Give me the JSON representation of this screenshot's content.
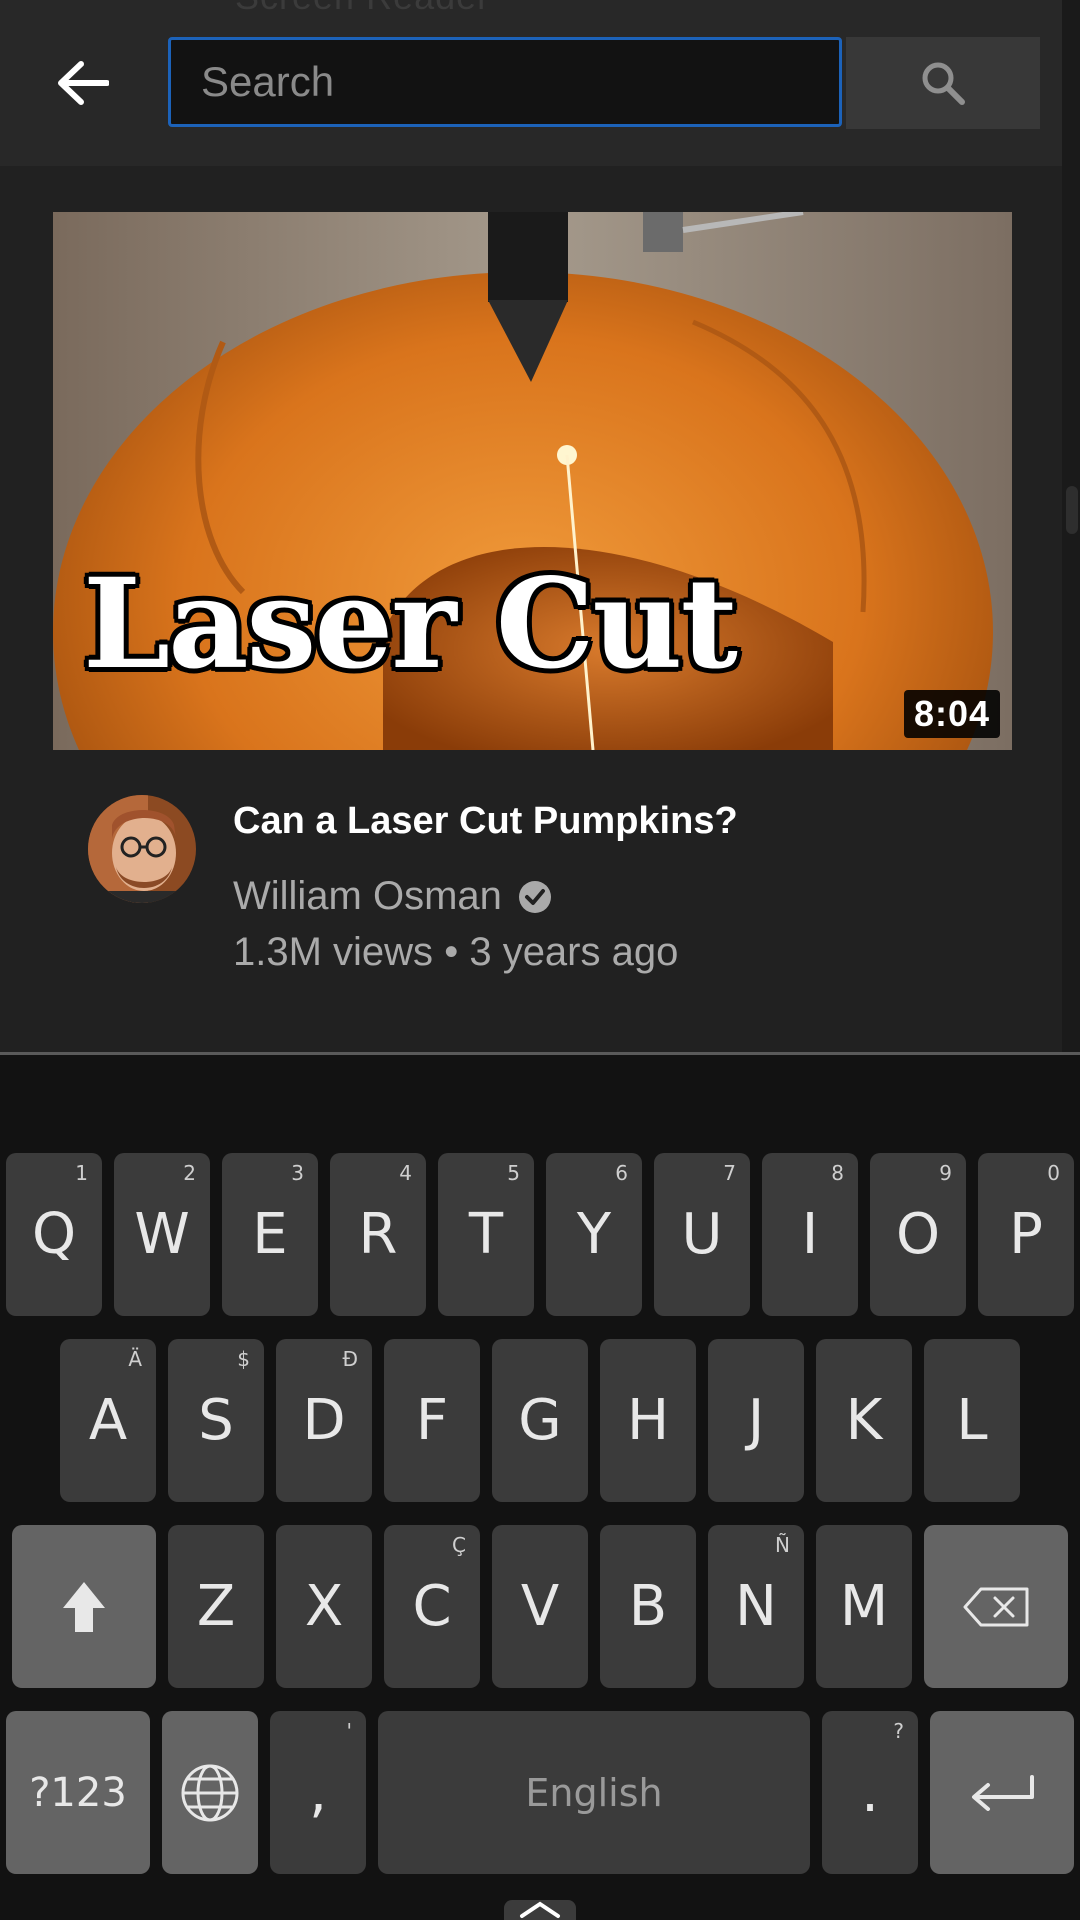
{
  "header": {
    "peek_text": "Screen Reader",
    "search_placeholder": "Search",
    "search_value": ""
  },
  "video": {
    "thumbnail_caption": "Laser Cut",
    "duration": "8:04",
    "title": "Can a Laser Cut Pumpkins?",
    "channel": "William Osman",
    "views": "1.3M views",
    "separator": "•",
    "age": "3 years ago"
  },
  "keyboard": {
    "row1": [
      {
        "key": "Q",
        "hint": "1"
      },
      {
        "key": "W",
        "hint": "2"
      },
      {
        "key": "E",
        "hint": "3"
      },
      {
        "key": "R",
        "hint": "4"
      },
      {
        "key": "T",
        "hint": "5"
      },
      {
        "key": "Y",
        "hint": "6"
      },
      {
        "key": "U",
        "hint": "7"
      },
      {
        "key": "I",
        "hint": "8"
      },
      {
        "key": "O",
        "hint": "9"
      },
      {
        "key": "P",
        "hint": "0"
      }
    ],
    "row2": [
      {
        "key": "A",
        "hint": "Ä"
      },
      {
        "key": "S",
        "hint": "$"
      },
      {
        "key": "D",
        "hint": "Ð"
      },
      {
        "key": "F",
        "hint": ""
      },
      {
        "key": "G",
        "hint": ""
      },
      {
        "key": "H",
        "hint": ""
      },
      {
        "key": "J",
        "hint": ""
      },
      {
        "key": "K",
        "hint": ""
      },
      {
        "key": "L",
        "hint": ""
      }
    ],
    "row3": [
      {
        "key": "Z",
        "hint": ""
      },
      {
        "key": "X",
        "hint": ""
      },
      {
        "key": "C",
        "hint": "Ç"
      },
      {
        "key": "V",
        "hint": ""
      },
      {
        "key": "B",
        "hint": ""
      },
      {
        "key": "N",
        "hint": "Ñ"
      },
      {
        "key": "M",
        "hint": ""
      }
    ],
    "symbols_label": "?123",
    "comma": ",",
    "comma_hint": "'",
    "space_label": "English",
    "period": ".",
    "period_hint": "?"
  },
  "icons": [
    "back-arrow-icon",
    "search-icon",
    "verified-icon",
    "shift-icon",
    "backspace-icon",
    "globe-icon",
    "enter-icon",
    "chevron-up-icon"
  ],
  "colors": {
    "background": "#212121",
    "search_border": "#1c62b9",
    "keyboard_bg": "#121212",
    "key": "#3b3b3b",
    "func_key": "#646464"
  }
}
